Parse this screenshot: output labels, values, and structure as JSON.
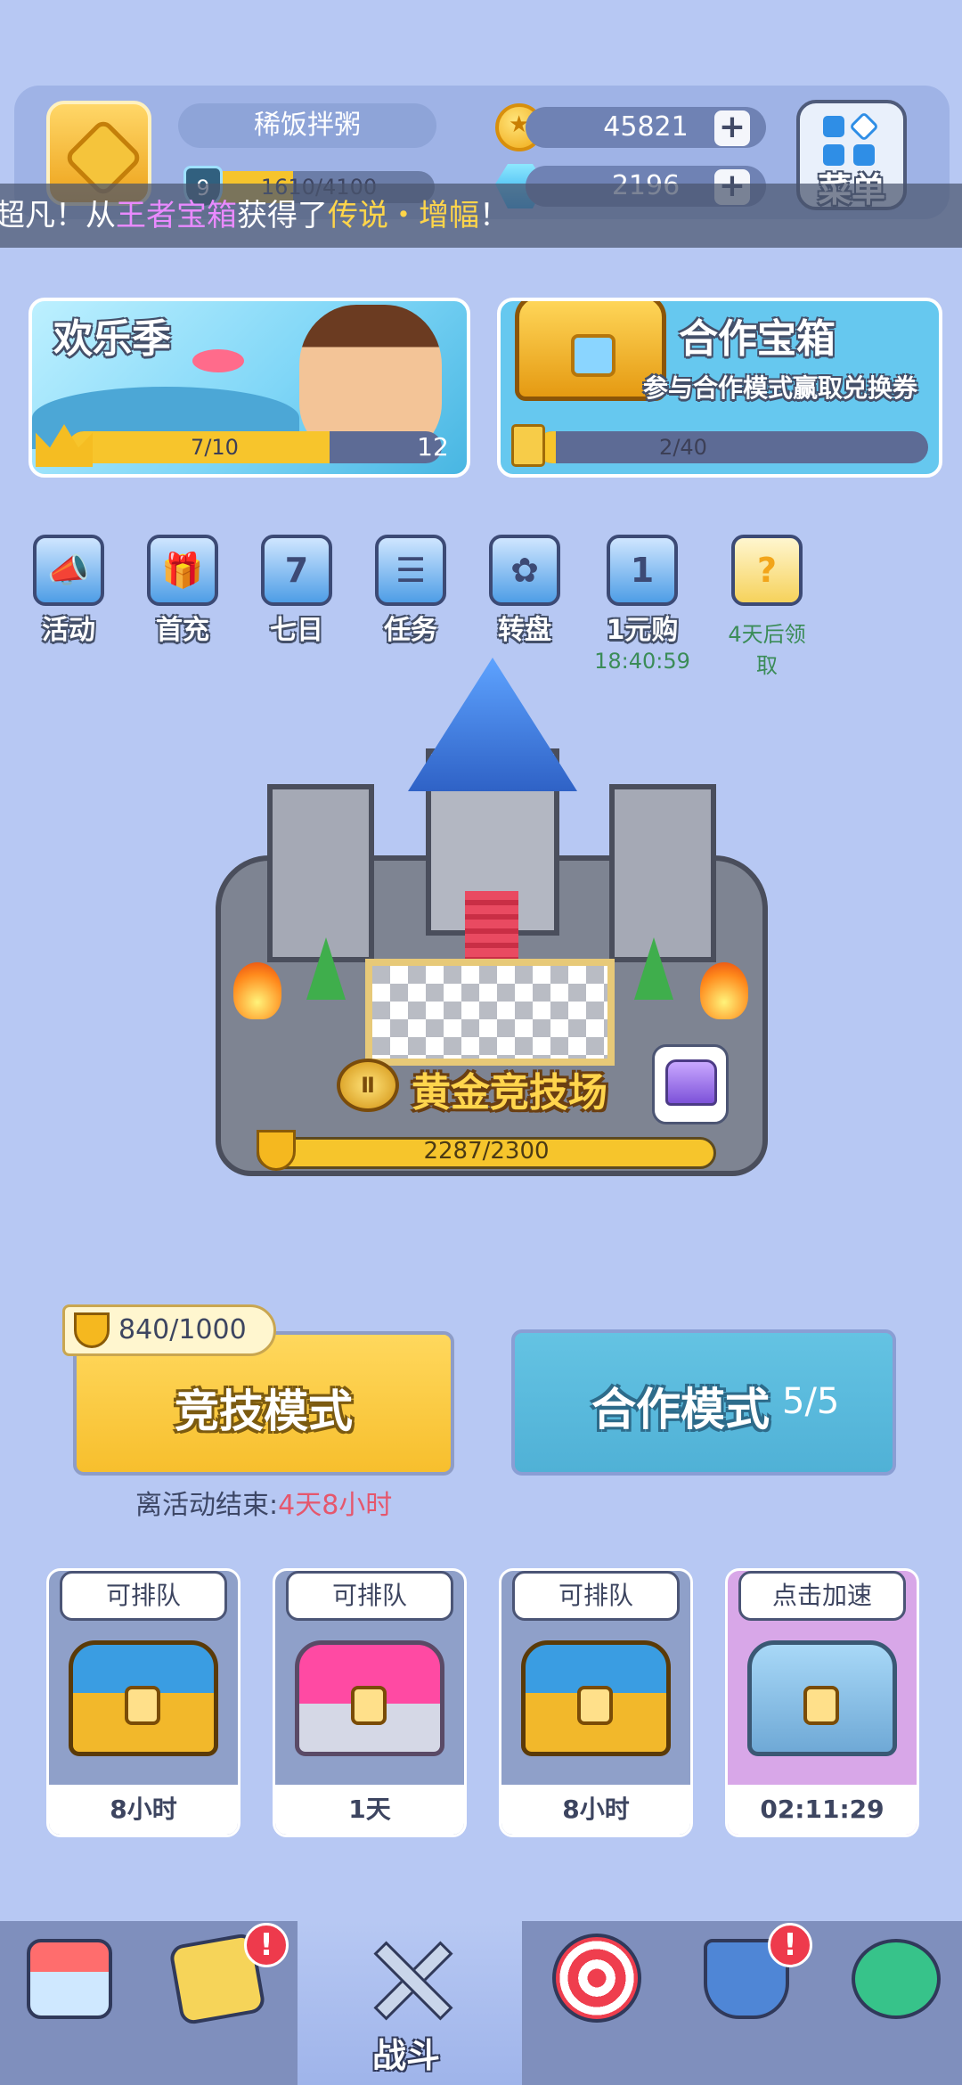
{
  "player": {
    "name": "稀饭拌粥",
    "level": "9",
    "exp": "1610/4100",
    "exp_fraction": 0.39
  },
  "resources": {
    "coins": "45821",
    "gems": "2196",
    "plus": "+"
  },
  "menu": {
    "label": "菜单"
  },
  "ticker": {
    "prefix": "超凡！从",
    "source": "王者宝箱",
    "mid": "获得了",
    "item": "传说・增幅",
    "suffix": "！"
  },
  "banners": {
    "joy_season": {
      "title": "欢乐季",
      "progress": "7/10",
      "progress_fraction": 0.7,
      "level": "12"
    },
    "coop_chest": {
      "title": "合作宝箱",
      "subtitle": "参与合作模式赢取兑换券",
      "progress": "2/40",
      "progress_fraction": 0.05
    }
  },
  "icons": [
    {
      "label": "活动",
      "icon": "megaphone-icon",
      "glyph": "📣"
    },
    {
      "label": "首充",
      "icon": "gift-icon",
      "glyph": "🎁"
    },
    {
      "label": "七日",
      "icon": "seven-day-icon",
      "glyph": "7"
    },
    {
      "label": "任务",
      "icon": "task-clipboard-icon",
      "glyph": "☰"
    },
    {
      "label": "转盘",
      "icon": "wheel-icon",
      "glyph": "✿"
    },
    {
      "label": "1元购",
      "icon": "one-yuan-icon",
      "glyph": "1",
      "sub": "18:40:59"
    },
    {
      "label": "",
      "icon": "mystery-icon",
      "glyph": "?",
      "sub": "4天后领取"
    }
  ],
  "arena": {
    "name": "黄金竞技场",
    "rank": "Ⅱ",
    "trophies": "2287/2300",
    "trophy_fraction": 0.994
  },
  "modes": {
    "competitive": {
      "label": "竞技模式",
      "tag": "840/1000"
    },
    "coop": {
      "label": "合作模式",
      "count": "5/5"
    }
  },
  "event": {
    "prefix": "离活动结束:",
    "time": "4天8小时"
  },
  "chests": [
    {
      "tag": "可排队",
      "time": "8小时",
      "type": "gold"
    },
    {
      "tag": "可排队",
      "time": "1天",
      "type": "pink"
    },
    {
      "tag": "可排队",
      "time": "8小时",
      "type": "gold"
    },
    {
      "tag": "点击加速",
      "time": "02:11:29",
      "type": "silver"
    }
  ],
  "nav": {
    "battle_label": "战斗",
    "alert": "!"
  },
  "colors": {
    "background": "#b7c8f3",
    "gold": "#f7c52c",
    "coop_blue": "#5ab8dd",
    "alert_red": "#ee3a4c",
    "highlight_purple": "#e98aff",
    "highlight_yellow": "#ffd54a"
  }
}
